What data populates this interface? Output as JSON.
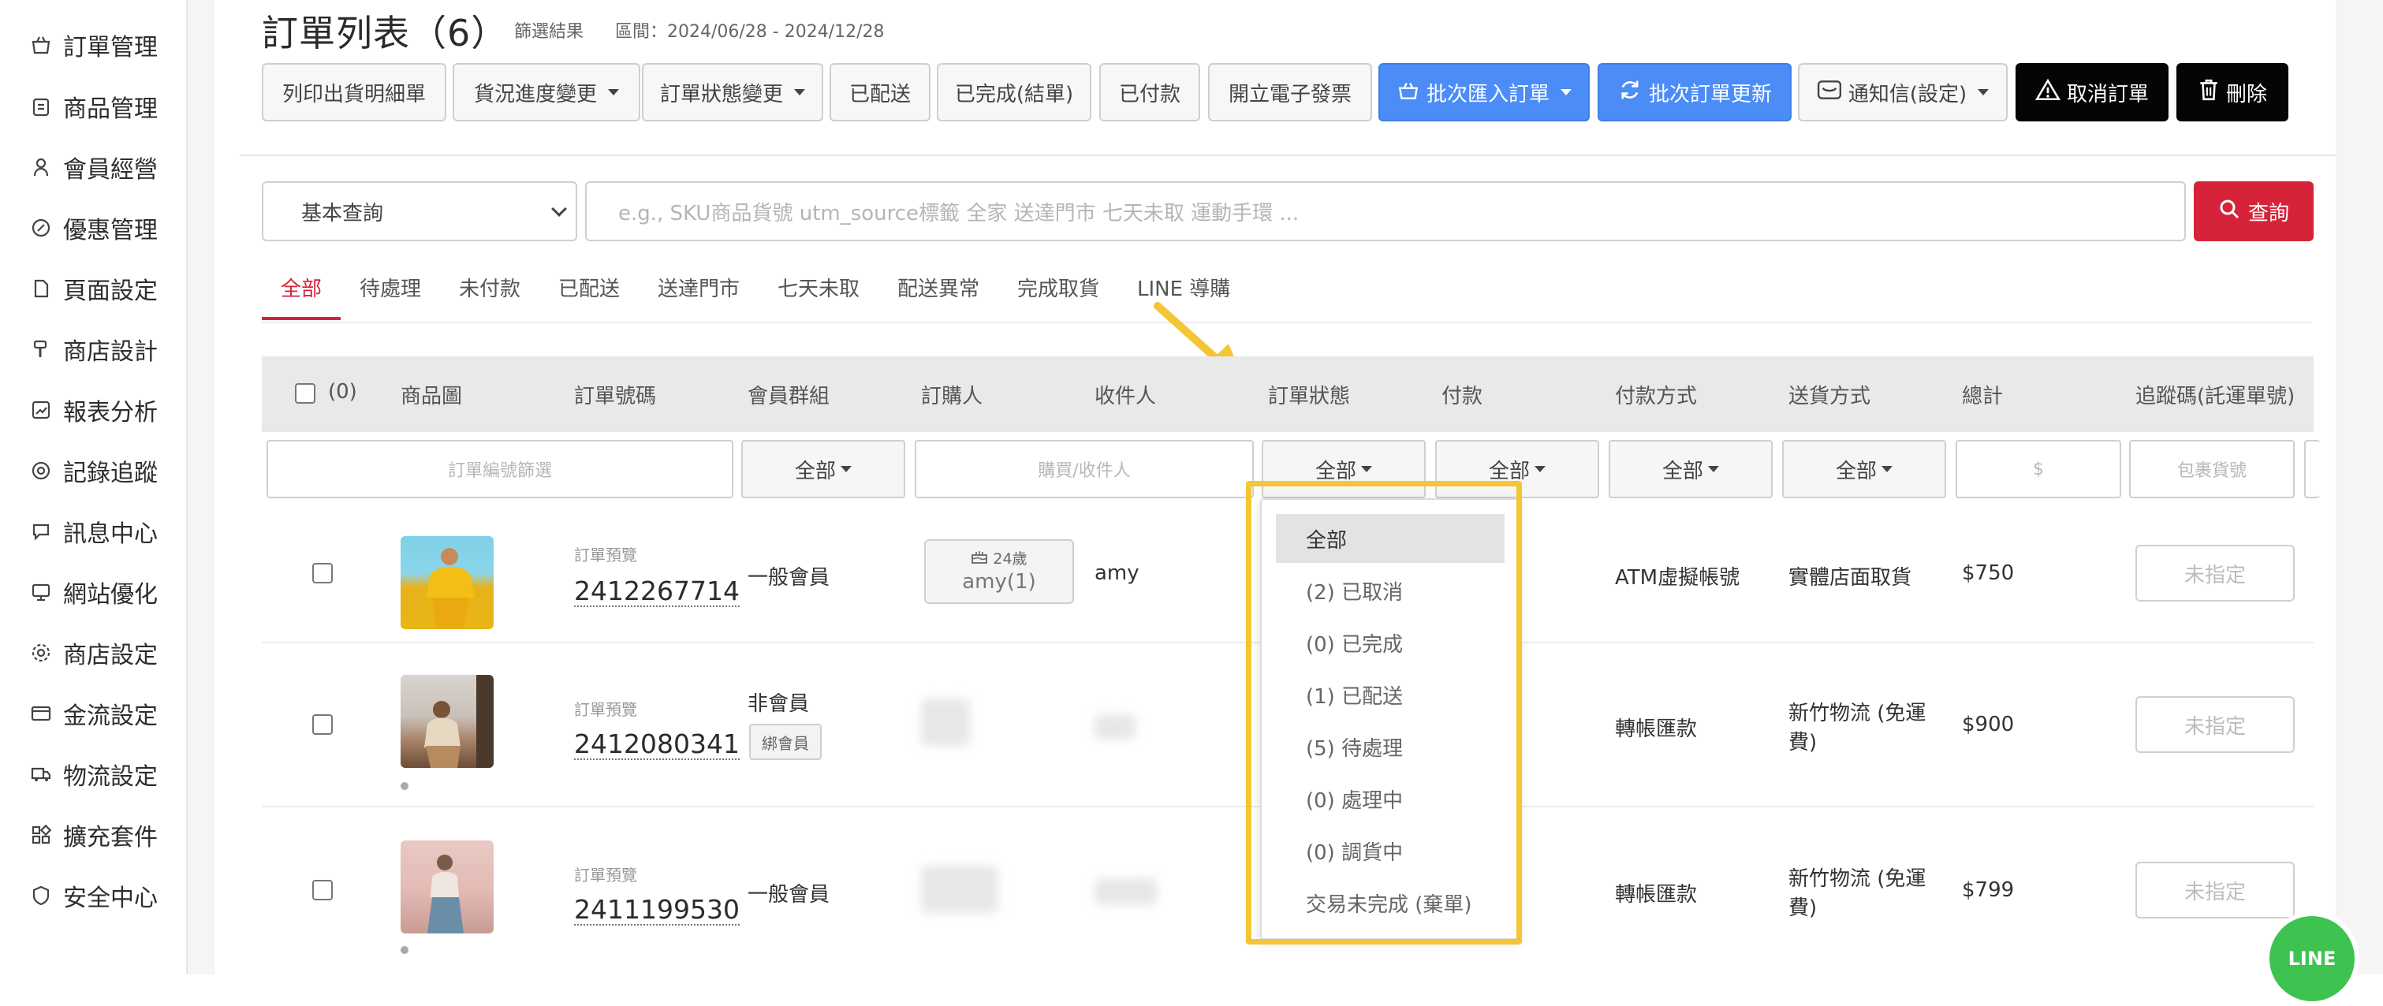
{
  "sidebar": {
    "items": [
      {
        "label": "訂單管理",
        "icon": "basket-icon"
      },
      {
        "label": "商品管理",
        "icon": "clipboard-icon"
      },
      {
        "label": "會員經營",
        "icon": "user-icon"
      },
      {
        "label": "優惠管理",
        "icon": "discount-icon"
      },
      {
        "label": "頁面設定",
        "icon": "page-icon"
      },
      {
        "label": "商店設計",
        "icon": "brush-icon"
      },
      {
        "label": "報表分析",
        "icon": "chart-icon"
      },
      {
        "label": "記錄追蹤",
        "icon": "target-icon"
      },
      {
        "label": "訊息中心",
        "icon": "message-icon"
      },
      {
        "label": "網站優化",
        "icon": "monitor-icon"
      },
      {
        "label": "商店設定",
        "icon": "gear-icon"
      },
      {
        "label": "金流設定",
        "icon": "card-icon"
      },
      {
        "label": "物流設定",
        "icon": "truck-icon"
      },
      {
        "label": "擴充套件",
        "icon": "extension-icon"
      },
      {
        "label": "安全中心",
        "icon": "shield-icon"
      }
    ]
  },
  "header": {
    "title": "訂單列表（6）",
    "filter_note": "篩選結果",
    "date_range": "區間：2024/06/28 - 2024/12/28"
  },
  "toolbar": {
    "print": "列印出貨明細單",
    "shipping_progress": "貨況進度變更",
    "order_status_change": "訂單狀態變更",
    "shipped": "已配送",
    "completed": "已完成(結單)",
    "paid": "已付款",
    "invoice": "開立電子發票",
    "batch_import": "批次匯入訂單",
    "batch_update": "批次訂單更新",
    "notify": "通知信(設定)",
    "cancel": "取消訂單",
    "delete": "刪除"
  },
  "search": {
    "mode": "基本查詢",
    "placeholder": "e.g.,  SKU商品貨號   utm_source標籤   全家   送達門市   七天未取   運動手環  ...",
    "button": "查詢"
  },
  "tabs": [
    "全部",
    "待處理",
    "未付款",
    "已配送",
    "送達門市",
    "七天未取",
    "配送異常",
    "完成取貨",
    "LINE 導購"
  ],
  "table": {
    "selected_count": "(0)",
    "columns": [
      "商品圖",
      "訂單號碼",
      "會員群組",
      "訂購人",
      "收件人",
      "訂單狀態",
      "付款",
      "付款方式",
      "送貨方式",
      "總計",
      "追蹤碼(託運單號)"
    ],
    "filters": {
      "order_no_placeholder": "訂單編號篩選",
      "member_group": "全部",
      "person_placeholder": "購買/收件人",
      "status": "全部",
      "payment": "全部",
      "payment_method": "全部",
      "shipping": "全部",
      "total_placeholder": "$",
      "tracking_placeholder": "包裹貨號"
    },
    "rows": [
      {
        "preview": "訂單預覽",
        "order_no": "2412267714",
        "member": "一般會員",
        "buyer_age": "24歲",
        "buyer": "amy(1)",
        "recipient": "amy",
        "pay_method": "ATM虛擬帳號",
        "shipping": "實體店面取貨",
        "total": "$750",
        "tracking": "未指定"
      },
      {
        "preview": "訂單預覽",
        "order_no": "2412080341",
        "member": "非會員",
        "bind": "綁會員",
        "pay_method": "轉帳匯款",
        "shipping_l1": "新竹物流 (免運",
        "shipping_l2": "費)",
        "total": "$900",
        "tracking": "未指定"
      },
      {
        "preview": "訂單預覽",
        "order_no": "2411199530",
        "member": "一般會員",
        "pay_method": "轉帳匯款",
        "shipping_l1": "新竹物流 (免運",
        "shipping_l2": "費)",
        "total": "$799",
        "tracking": "未指定"
      }
    ]
  },
  "status_dropdown": {
    "options": [
      "全部",
      "(2) 已取消",
      "(0) 已完成",
      "(1) 已配送",
      "(5) 待處理",
      "(0) 處理中",
      "(0) 調貨中",
      "交易未完成 (棄單)"
    ],
    "selected": "全部"
  },
  "line_badge": "LINE",
  "colors": {
    "accent_red": "#d6233a",
    "accent_blue": "#4b8cf7",
    "highlight_yellow": "#f4c534",
    "line_green": "#3ec351"
  }
}
